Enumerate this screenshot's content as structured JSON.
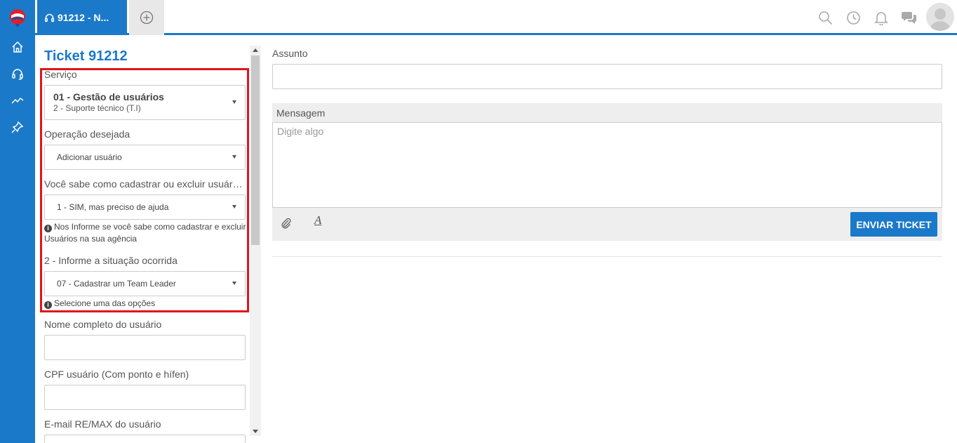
{
  "rail": {
    "logo": "remax-balloon-logo",
    "items": [
      {
        "icon": "home-icon"
      },
      {
        "icon": "headset-icon"
      },
      {
        "icon": "trend-chart-icon"
      },
      {
        "icon": "pin-icon"
      }
    ]
  },
  "topbar": {
    "active_tab_label": "91212 - N...",
    "icons": [
      "search-icon",
      "history-clock-icon",
      "bell-icon",
      "chat-icon"
    ]
  },
  "ticket": {
    "title": "Ticket 91212",
    "servico": {
      "label": "Serviço",
      "line1": "01 - Gestão de usuários",
      "line2": "2 - Suporte técnico (T.I)"
    },
    "operacao": {
      "label": "Operação desejada",
      "value": "Adicionar usuário"
    },
    "sabe": {
      "label": "Você sabe como cadastrar ou excluir usuários?",
      "value": "1 - SIM, mas preciso de ajuda",
      "help": "Nos Informe se você sabe como cadastrar e excluir Usuários na sua agência"
    },
    "situacao": {
      "label": "2 - Informe a situação ocorrida",
      "value": "07 - Cadastrar um Team Leader",
      "help": "Selecione uma das opções"
    },
    "nome": {
      "label": "Nome completo do usuário",
      "value": ""
    },
    "cpf": {
      "label": "CPF usuário (Com ponto e hífen)",
      "value": ""
    },
    "email": {
      "label": "E-mail RE/MAX do usuário",
      "value": ""
    }
  },
  "message": {
    "subject_label": "Assunto",
    "subject_value": "",
    "mensagem_label": "Mensagem",
    "placeholder": "Digite algo",
    "send_label": "ENVIAR TICKET"
  },
  "colors": {
    "brand_blue": "#1b79c9",
    "highlight_red": "#e0151b"
  }
}
